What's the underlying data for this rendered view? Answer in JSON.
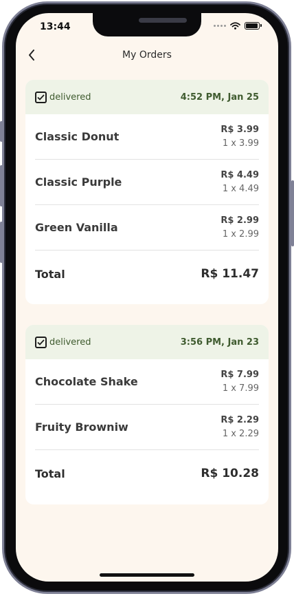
{
  "status_bar": {
    "time": "13:44"
  },
  "header": {
    "title": "My Orders"
  },
  "orders": [
    {
      "status": "delivered",
      "time": "4:52 PM, Jan 25",
      "items": [
        {
          "name": "Classic Donut",
          "price": "R$ 3.99",
          "qty": "1 x 3.99"
        },
        {
          "name": "Classic Purple",
          "price": "R$ 4.49",
          "qty": "1 x 4.49"
        },
        {
          "name": "Green Vanilla",
          "price": "R$ 2.99",
          "qty": "1 x 2.99"
        }
      ],
      "total_label": "Total",
      "total": "R$ 11.47"
    },
    {
      "status": "delivered",
      "time": "3:56 PM, Jan 23",
      "items": [
        {
          "name": "Chocolate Shake",
          "price": "R$ 7.99",
          "qty": "1 x 7.99"
        },
        {
          "name": "Fruity Browniw",
          "price": "R$ 2.29",
          "qty": "1 x 2.29"
        }
      ],
      "total_label": "Total",
      "total": "R$ 10.28"
    }
  ],
  "icons": {
    "back": "chevron-left-icon",
    "status": "checkbox-checked-icon",
    "wifi": "wifi-icon",
    "battery": "battery-icon",
    "signal": "signal-icon"
  },
  "colors": {
    "background": "#fdf6ee",
    "card": "#ffffff",
    "header_band": "#eef3e7",
    "accent_green": "#3f5b2f"
  }
}
